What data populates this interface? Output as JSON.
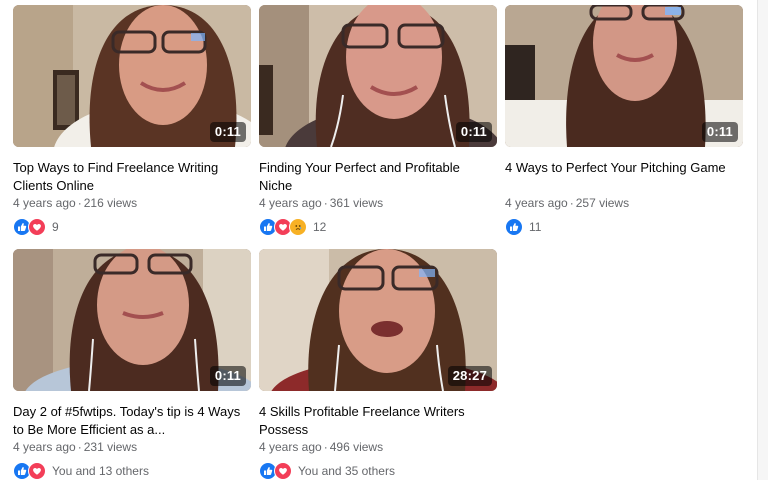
{
  "videos": [
    {
      "title": "Top Ways to Find Freelance Writing Clients Online",
      "age": "4 years ago",
      "views": "216 views",
      "duration": "0:11",
      "reactions": [
        "like",
        "love"
      ],
      "reaction_text": "9"
    },
    {
      "title": "Finding Your Perfect and Profitable Niche",
      "age": "4 years ago",
      "views": "361 views",
      "duration": "0:11",
      "reactions": [
        "like",
        "love",
        "sad"
      ],
      "reaction_text": "12"
    },
    {
      "title": "4 Ways to Perfect Your Pitching Game",
      "age": "4 years ago",
      "views": "257 views",
      "duration": "0:11",
      "reactions": [
        "like"
      ],
      "reaction_text": "11"
    },
    {
      "title": "Day 2 of #5fwtips. Today's tip is 4 Ways to Be More Efficient as a...",
      "age": "4 years ago",
      "views": "231 views",
      "duration": "0:11",
      "reactions": [
        "like",
        "love"
      ],
      "reaction_text": "You and 13 others"
    },
    {
      "title": "4 Skills Profitable Freelance Writers Possess",
      "age": "4 years ago",
      "views": "496 views",
      "duration": "28:27",
      "reactions": [
        "like",
        "love"
      ],
      "reaction_text": "You and 35 others"
    }
  ],
  "separator": "·",
  "colors": {
    "like": "#1877f2",
    "love": "#f33e58",
    "sad": "#f7b125",
    "meta_text": "#65676b",
    "title_text": "#050505"
  }
}
